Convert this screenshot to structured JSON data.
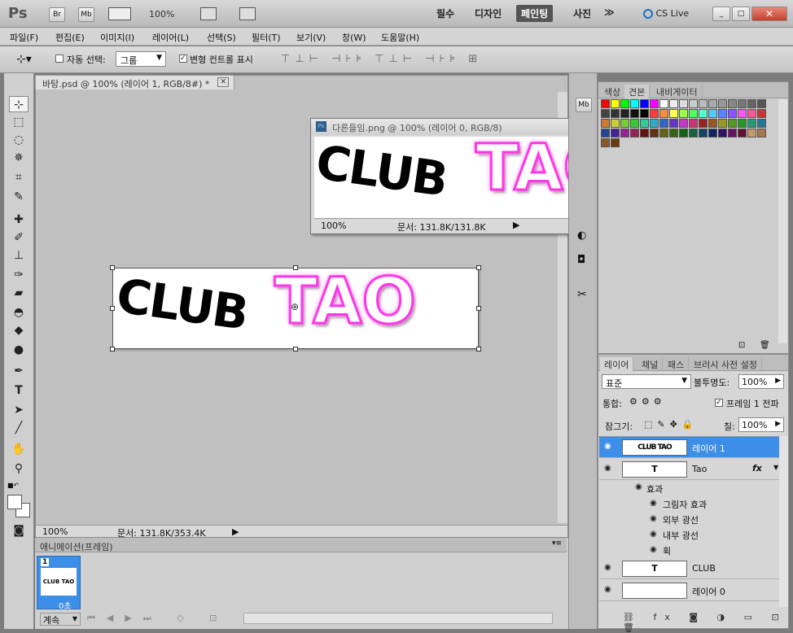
{
  "app": {
    "logo": "Ps",
    "bridge": "Br",
    "mini_bridge": "Mb",
    "zoom": "100%",
    "workspaces": [
      "필수",
      "디자인",
      "페인팅",
      "사진"
    ],
    "more": "≫",
    "cs_live": "CS Live"
  },
  "menu": [
    "파일(F)",
    "편집(E)",
    "이미지(I)",
    "레이어(L)",
    "선택(S)",
    "필터(T)",
    "보기(V)",
    "창(W)",
    "도움말(H)"
  ],
  "options": {
    "auto_select_label": "자동 선택:",
    "auto_select_value": "그룹",
    "transform_controls": "변형 컨트롤 표시"
  },
  "document": {
    "tab_title": "바탕.psd @ 100% (레이어 1, RGB/8#) *",
    "zoom": "100%",
    "status": "문서: 131.8K/353.4K",
    "text_club": "CLUB",
    "text_tao": "TAO"
  },
  "floating": {
    "title": "다른들임.png @ 100% (레이어 0, RGB/8)",
    "zoom": "100%",
    "status": "문서: 131.8K/131.8K"
  },
  "swatch_panel": {
    "tabs": [
      "색상",
      "견본",
      "내비게이터"
    ],
    "colors": [
      "#ff0000",
      "#ffff00",
      "#00ff00",
      "#00ffff",
      "#0000ff",
      "#ff00ff",
      "#ffffff",
      "#eeeeee",
      "#dddddd",
      "#cccccc",
      "#bbbbbb",
      "#aaaaaa",
      "#999999",
      "#888888",
      "#777777",
      "#666666",
      "#555555",
      "#444444",
      "#333333",
      "#222222",
      "#111111",
      "#000000",
      "#ff3a3a",
      "#ff8a3a",
      "#ffff55",
      "#9aff55",
      "#55ff55",
      "#55ffcc",
      "#55ccff",
      "#5588ff",
      "#8855ff",
      "#ff55ff",
      "#ff5599",
      "#cc3333",
      "#cc7a33",
      "#cccc33",
      "#7acc33",
      "#33cc33",
      "#33cc99",
      "#33aacc",
      "#3366cc",
      "#6633cc",
      "#cc33cc",
      "#cc3377",
      "#992222",
      "#995522",
      "#999922",
      "#559922",
      "#229922",
      "#229977",
      "#227799",
      "#224499",
      "#442299",
      "#992299",
      "#992255",
      "#661111",
      "#663311",
      "#666611",
      "#336611",
      "#116611",
      "#116644",
      "#114466",
      "#112266",
      "#331166",
      "#661166",
      "#661133",
      "#c89a6a",
      "#a8784a",
      "#88582a",
      "#6a3a10"
    ]
  },
  "layers_panel": {
    "tabs": [
      "레이어",
      "채널",
      "패스",
      "브러시 사전 설정"
    ],
    "blend_mode": "표준",
    "opacity_label": "불투명도:",
    "opacity": "100%",
    "unify_label": "통합:",
    "propagate_label": "프레임 1 전파",
    "lock_label": "잠그기:",
    "fill_label": "칠:",
    "fill": "100%",
    "layers": [
      {
        "name": "레이어 1",
        "thumb": "CLUB TAO",
        "selected": true
      },
      {
        "name": "Tao",
        "thumb": "T",
        "fx": "fx"
      },
      {
        "name": "CLUB",
        "thumb": "T"
      },
      {
        "name": "레이어 0",
        "thumb": ""
      }
    ],
    "effects_label": "효과",
    "effects": [
      "그림자 효과",
      "외부 광선",
      "내부 광선",
      "획"
    ]
  },
  "animation": {
    "title": "애니메이션(프레임)",
    "frame_number": "1",
    "frame_delay": "0초",
    "loop": "계속"
  }
}
